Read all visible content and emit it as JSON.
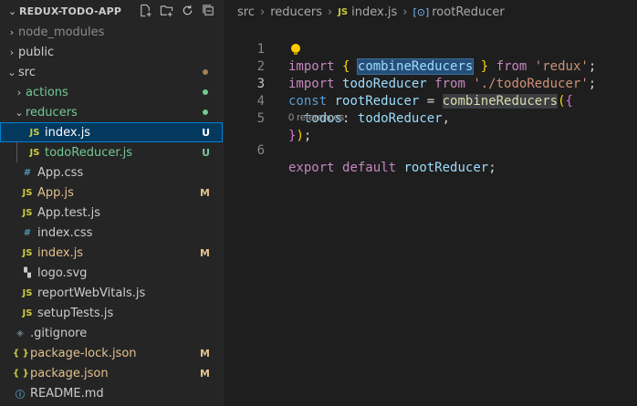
{
  "explorer": {
    "title": "REDUX-TODO-APP",
    "items": [
      {
        "label": "node_modules",
        "type": "folder",
        "expanded": false,
        "depth": 0,
        "color": "#8c8c8c",
        "badge": "",
        "dot": ""
      },
      {
        "label": "public",
        "type": "folder",
        "expanded": false,
        "depth": 0,
        "color": "#cccccc",
        "badge": "",
        "dot": ""
      },
      {
        "label": "src",
        "type": "folder",
        "expanded": true,
        "depth": 0,
        "color": "#cccccc",
        "badge": "",
        "dot": "#a67f59"
      },
      {
        "label": "actions",
        "type": "folder",
        "expanded": false,
        "depth": 1,
        "color": "#73c991",
        "badge": "",
        "dot": "#73c991"
      },
      {
        "label": "reducers",
        "type": "folder",
        "expanded": true,
        "depth": 1,
        "color": "#73c991",
        "badge": "",
        "dot": "#73c991"
      },
      {
        "label": "index.js",
        "type": "js",
        "depth": 2,
        "color": "#ffffff",
        "badge": "U",
        "badge_color": "#ffffff",
        "selected": true
      },
      {
        "label": "todoReducer.js",
        "type": "js",
        "depth": 2,
        "color": "#73c991",
        "badge": "U",
        "badge_color": "#73c991"
      },
      {
        "label": "App.css",
        "type": "css",
        "depth": 1,
        "color": "#cccccc",
        "badge": ""
      },
      {
        "label": "App.js",
        "type": "js",
        "depth": 1,
        "color": "#e2c08d",
        "badge": "M",
        "badge_color": "#e2c08d"
      },
      {
        "label": "App.test.js",
        "type": "js",
        "depth": 1,
        "color": "#cccccc",
        "badge": ""
      },
      {
        "label": "index.css",
        "type": "css",
        "depth": 1,
        "color": "#cccccc",
        "badge": ""
      },
      {
        "label": "index.js",
        "type": "js",
        "depth": 1,
        "color": "#e2c08d",
        "badge": "M",
        "badge_color": "#e2c08d"
      },
      {
        "label": "logo.svg",
        "type": "svg",
        "depth": 1,
        "color": "#cccccc",
        "badge": ""
      },
      {
        "label": "reportWebVitals.js",
        "type": "js",
        "depth": 1,
        "color": "#cccccc",
        "badge": ""
      },
      {
        "label": "setupTests.js",
        "type": "js",
        "depth": 1,
        "color": "#cccccc",
        "badge": ""
      },
      {
        "label": ".gitignore",
        "type": "git",
        "depth": 0,
        "color": "#cccccc",
        "badge": ""
      },
      {
        "label": "package-lock.json",
        "type": "json",
        "depth": 0,
        "color": "#e2c08d",
        "badge": "M",
        "badge_color": "#e2c08d"
      },
      {
        "label": "package.json",
        "type": "json",
        "depth": 0,
        "color": "#e2c08d",
        "badge": "M",
        "badge_color": "#e2c08d"
      },
      {
        "label": "README.md",
        "type": "info",
        "depth": 0,
        "color": "#cccccc",
        "badge": ""
      }
    ],
    "icons": {
      "js": "JS",
      "css": "#",
      "json": "{ }",
      "svg": "▚",
      "git": "◈",
      "info": "ⓘ"
    }
  },
  "breadcrumb": {
    "parts": [
      "src",
      "reducers",
      "index.js",
      "rootReducer"
    ],
    "file_icon": "JS"
  },
  "editor": {
    "line_numbers": [
      "1",
      "2",
      "3",
      "4",
      "5",
      "6"
    ],
    "code_lens": "0 references",
    "tokens": {
      "import": "import",
      "lbrace": "{",
      "combineReducers": "combineReducers",
      "rbrace": "}",
      "from": "from",
      "redux_str": "'redux'",
      "semi": ";",
      "todoReducer": "todoReducer",
      "todo_path": "'./todoReducer'",
      "const": "const",
      "rootReducer": "rootReducer",
      "eq": "=",
      "lparen": "(",
      "todos": "todos",
      "colon": ":",
      "comma": ",",
      "rparen": ")",
      "export": "export",
      "default": "default"
    }
  }
}
